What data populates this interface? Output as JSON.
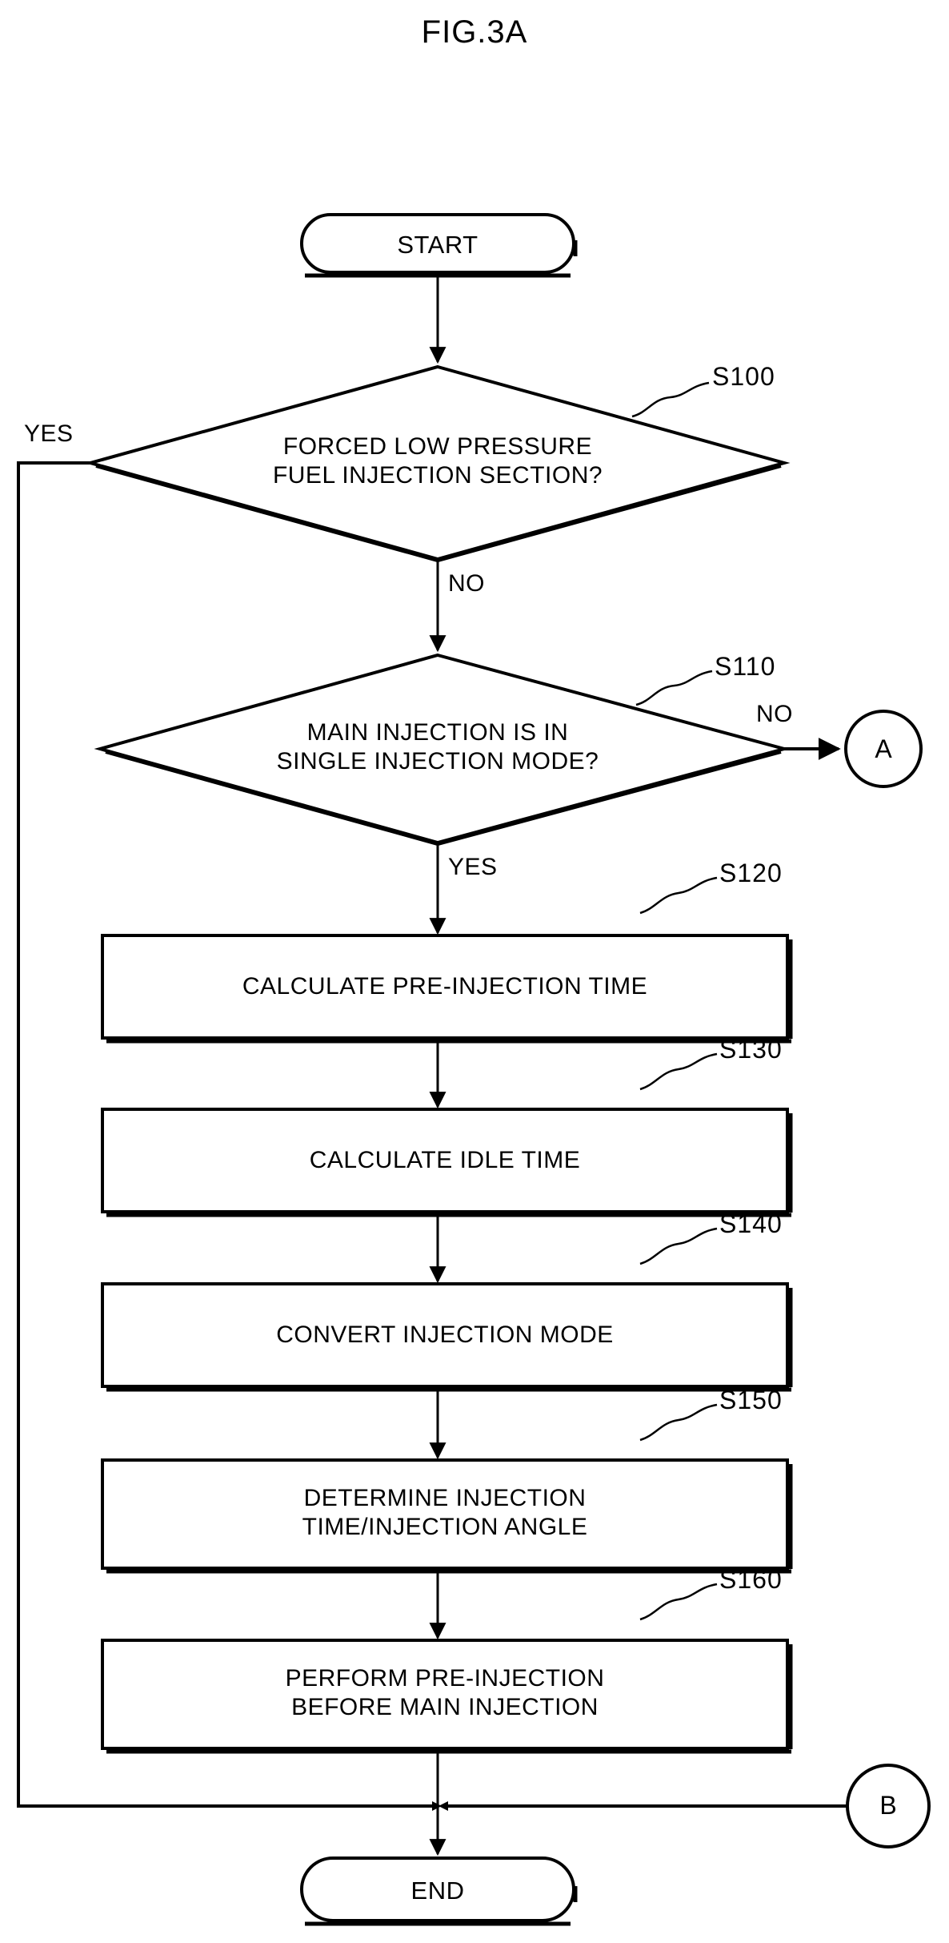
{
  "figure": {
    "title": "FIG.3A"
  },
  "nodes": {
    "start": {
      "label": "START",
      "shape": "terminator"
    },
    "end": {
      "label": "END",
      "shape": "terminator"
    },
    "d1": {
      "label": "FORCED LOW PRESSURE\nFUEL INJECTION SECTION?",
      "shape": "decision",
      "step": "S100"
    },
    "d2": {
      "label": "MAIN INJECTION IS IN\nSINGLE INJECTION MODE?",
      "shape": "decision",
      "step": "S110"
    },
    "p120": {
      "label": "CALCULATE PRE-INJECTION TIME",
      "shape": "process",
      "step": "S120"
    },
    "p130": {
      "label": "CALCULATE IDLE TIME",
      "shape": "process",
      "step": "S130"
    },
    "p140": {
      "label": "CONVERT INJECTION MODE",
      "shape": "process",
      "step": "S140"
    },
    "p150": {
      "label": "DETERMINE INJECTION\nTIME/INJECTION ANGLE",
      "shape": "process",
      "step": "S150"
    },
    "p160": {
      "label": "PERFORM PRE-INJECTION\nBEFORE MAIN INJECTION",
      "shape": "process",
      "step": "S160"
    },
    "connector_a": {
      "label": "A",
      "shape": "connector"
    },
    "connector_b": {
      "label": "B",
      "shape": "connector"
    }
  },
  "edge_labels": {
    "d1_yes": "YES",
    "d1_no": "NO",
    "d2_no": "NO",
    "d2_yes": "YES"
  },
  "colors": {
    "stroke": "#000000",
    "background": "#ffffff"
  },
  "chart_data": {
    "type": "flowchart",
    "title": "FIG.3A",
    "nodes": [
      {
        "id": "start",
        "type": "terminator",
        "text": "START"
      },
      {
        "id": "S100",
        "type": "decision",
        "text": "FORCED LOW PRESSURE FUEL INJECTION SECTION?",
        "step": "S100"
      },
      {
        "id": "S110",
        "type": "decision",
        "text": "MAIN INJECTION IS IN SINGLE INJECTION MODE?",
        "step": "S110"
      },
      {
        "id": "S120",
        "type": "process",
        "text": "CALCULATE PRE-INJECTION TIME",
        "step": "S120"
      },
      {
        "id": "S130",
        "type": "process",
        "text": "CALCULATE IDLE TIME",
        "step": "S130"
      },
      {
        "id": "S140",
        "type": "process",
        "text": "CONVERT INJECTION MODE",
        "step": "S140"
      },
      {
        "id": "S150",
        "type": "process",
        "text": "DETERMINE INJECTION TIME/INJECTION ANGLE",
        "step": "S150"
      },
      {
        "id": "S160",
        "type": "process",
        "text": "PERFORM PRE-INJECTION BEFORE MAIN INJECTION",
        "step": "S160"
      },
      {
        "id": "A",
        "type": "connector",
        "text": "A"
      },
      {
        "id": "B",
        "type": "connector",
        "text": "B"
      },
      {
        "id": "end",
        "type": "terminator",
        "text": "END"
      }
    ],
    "edges": [
      {
        "from": "start",
        "to": "S100",
        "label": ""
      },
      {
        "from": "S100",
        "to": "end",
        "label": "YES"
      },
      {
        "from": "S100",
        "to": "S110",
        "label": "NO"
      },
      {
        "from": "S110",
        "to": "A",
        "label": "NO"
      },
      {
        "from": "S110",
        "to": "S120",
        "label": "YES"
      },
      {
        "from": "S120",
        "to": "S130",
        "label": ""
      },
      {
        "from": "S130",
        "to": "S140",
        "label": ""
      },
      {
        "from": "S140",
        "to": "S150",
        "label": ""
      },
      {
        "from": "S150",
        "to": "S160",
        "label": ""
      },
      {
        "from": "S160",
        "to": "end",
        "label": ""
      },
      {
        "from": "B",
        "to": "end",
        "label": ""
      }
    ]
  }
}
